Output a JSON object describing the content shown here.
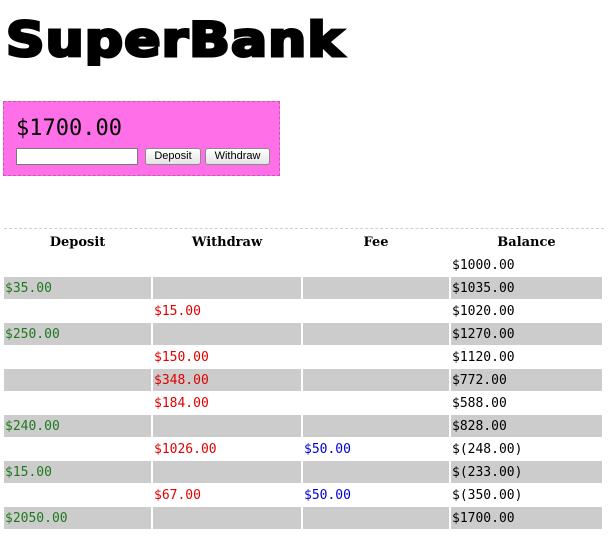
{
  "app": {
    "logo_text": "SuperBank"
  },
  "account": {
    "balance": "$1700.00",
    "amount_placeholder": "",
    "deposit_label": "Deposit",
    "withdraw_label": "Withdraw"
  },
  "ledger": {
    "headers": {
      "deposit": "Deposit",
      "withdraw": "Withdraw",
      "fee": "Fee",
      "balance": "Balance"
    },
    "rows": [
      {
        "deposit": "",
        "withdraw": "",
        "fee": "",
        "balance": "$1000.00"
      },
      {
        "deposit": "$35.00",
        "withdraw": "",
        "fee": "",
        "balance": "$1035.00"
      },
      {
        "deposit": "",
        "withdraw": "$15.00",
        "fee": "",
        "balance": "$1020.00"
      },
      {
        "deposit": "$250.00",
        "withdraw": "",
        "fee": "",
        "balance": "$1270.00"
      },
      {
        "deposit": "",
        "withdraw": "$150.00",
        "fee": "",
        "balance": "$1120.00"
      },
      {
        "deposit": "",
        "withdraw": "$348.00",
        "fee": "",
        "balance": "$772.00"
      },
      {
        "deposit": "",
        "withdraw": "$184.00",
        "fee": "",
        "balance": "$588.00"
      },
      {
        "deposit": "$240.00",
        "withdraw": "",
        "fee": "",
        "balance": "$828.00"
      },
      {
        "deposit": "",
        "withdraw": "$1026.00",
        "fee": "$50.00",
        "balance": "$(248.00)"
      },
      {
        "deposit": "$15.00",
        "withdraw": "",
        "fee": "",
        "balance": "$(233.00)"
      },
      {
        "deposit": "",
        "withdraw": "$67.00",
        "fee": "$50.00",
        "balance": "$(350.00)"
      },
      {
        "deposit": "$2050.00",
        "withdraw": "",
        "fee": "",
        "balance": "$1700.00"
      }
    ]
  },
  "colors": {
    "panel_background": "#ff6fe8",
    "row_shade": "#cccccc",
    "deposit_text": "#1e7a1e",
    "withdraw_text": "#e00000",
    "fee_text": "#0000d0"
  }
}
